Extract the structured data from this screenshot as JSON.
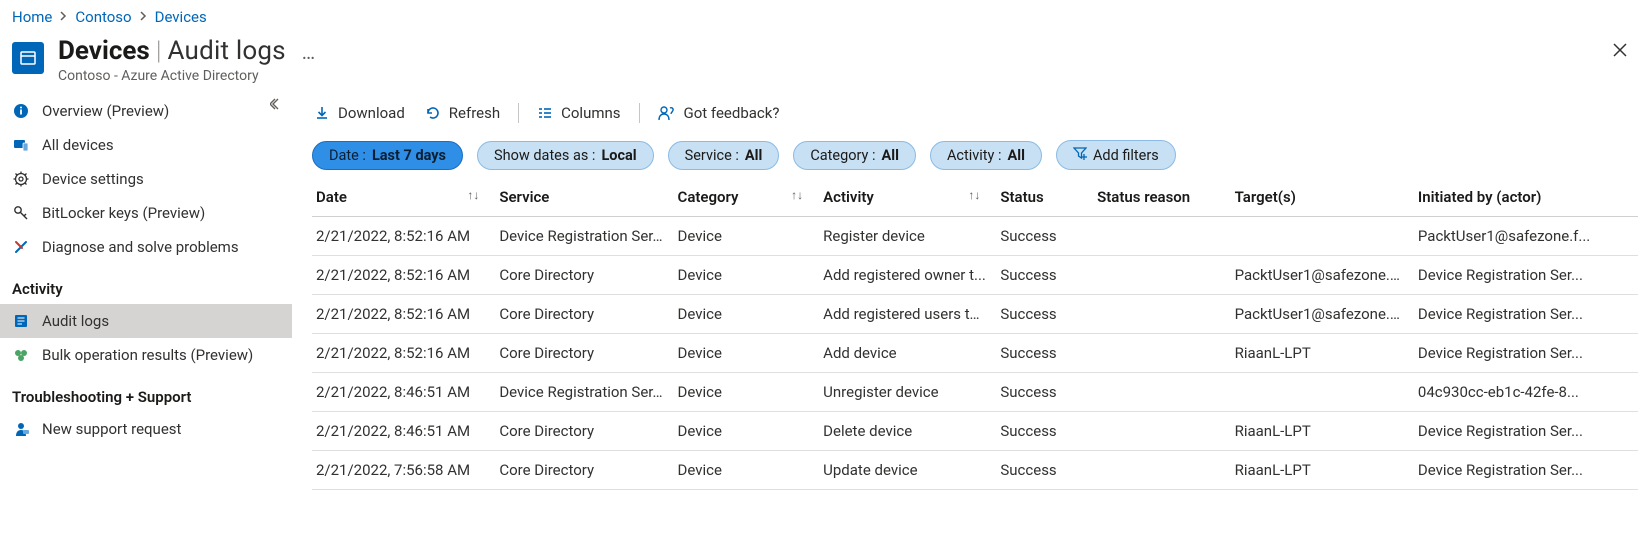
{
  "breadcrumb": {
    "items": [
      "Home",
      "Contoso",
      "Devices"
    ]
  },
  "header": {
    "title_main": "Devices",
    "title_sub": "Audit logs",
    "subtitle": "Contoso - Azure Active Directory"
  },
  "sidebar": {
    "items": [
      {
        "label": "Overview (Preview)",
        "icon": "info"
      },
      {
        "label": "All devices",
        "icon": "devices"
      },
      {
        "label": "Device settings",
        "icon": "gear"
      },
      {
        "label": "BitLocker keys (Preview)",
        "icon": "key"
      },
      {
        "label": "Diagnose and solve problems",
        "icon": "wrench"
      }
    ],
    "section_activity": "Activity",
    "activity_items": [
      {
        "label": "Audit logs",
        "icon": "log",
        "selected": true
      },
      {
        "label": "Bulk operation results (Preview)",
        "icon": "bulk"
      }
    ],
    "section_troubleshoot": "Troubleshooting + Support",
    "troubleshoot_items": [
      {
        "label": "New support request",
        "icon": "support"
      }
    ]
  },
  "toolbar": {
    "download": "Download",
    "refresh": "Refresh",
    "columns": "Columns",
    "feedback": "Got feedback?"
  },
  "filters": {
    "date": {
      "label": "Date : ",
      "value": "Last 7 days"
    },
    "show_dates": {
      "label": "Show dates as : ",
      "value": "Local"
    },
    "service": {
      "label": "Service : ",
      "value": "All"
    },
    "category": {
      "label": "Category : ",
      "value": "All"
    },
    "activity": {
      "label": "Activity : ",
      "value": "All"
    },
    "add": "Add filters"
  },
  "table": {
    "headers": {
      "date": "Date",
      "service": "Service",
      "category": "Category",
      "activity": "Activity",
      "status": "Status",
      "status_reason": "Status reason",
      "targets": "Target(s)",
      "initiated_by": "Initiated by (actor)"
    },
    "rows": [
      {
        "date": "2/21/2022, 8:52:16 AM",
        "service": "Device Registration Ser...",
        "category": "Device",
        "activity": "Register device",
        "status": "Success",
        "status_reason": "",
        "targets": "",
        "initiated_by": "PacktUser1@safezone.f..."
      },
      {
        "date": "2/21/2022, 8:52:16 AM",
        "service": "Core Directory",
        "category": "Device",
        "activity": "Add registered owner t...",
        "status": "Success",
        "status_reason": "",
        "targets": "PacktUser1@safezone.f...",
        "initiated_by": "Device Registration Ser..."
      },
      {
        "date": "2/21/2022, 8:52:16 AM",
        "service": "Core Directory",
        "category": "Device",
        "activity": "Add registered users to...",
        "status": "Success",
        "status_reason": "",
        "targets": "PacktUser1@safezone.f...",
        "initiated_by": "Device Registration Ser..."
      },
      {
        "date": "2/21/2022, 8:52:16 AM",
        "service": "Core Directory",
        "category": "Device",
        "activity": "Add device",
        "status": "Success",
        "status_reason": "",
        "targets": "RiaanL-LPT",
        "initiated_by": "Device Registration Ser..."
      },
      {
        "date": "2/21/2022, 8:46:51 AM",
        "service": "Device Registration Ser...",
        "category": "Device",
        "activity": "Unregister device",
        "status": "Success",
        "status_reason": "",
        "targets": "",
        "initiated_by": "04c930cc-eb1c-42fe-8..."
      },
      {
        "date": "2/21/2022, 8:46:51 AM",
        "service": "Core Directory",
        "category": "Device",
        "activity": "Delete device",
        "status": "Success",
        "status_reason": "",
        "targets": "RiaanL-LPT",
        "initiated_by": "Device Registration Ser..."
      },
      {
        "date": "2/21/2022, 7:56:58 AM",
        "service": "Core Directory",
        "category": "Device",
        "activity": "Update device",
        "status": "Success",
        "status_reason": "",
        "targets": "RiaanL-LPT",
        "initiated_by": "Device Registration Ser..."
      }
    ]
  }
}
